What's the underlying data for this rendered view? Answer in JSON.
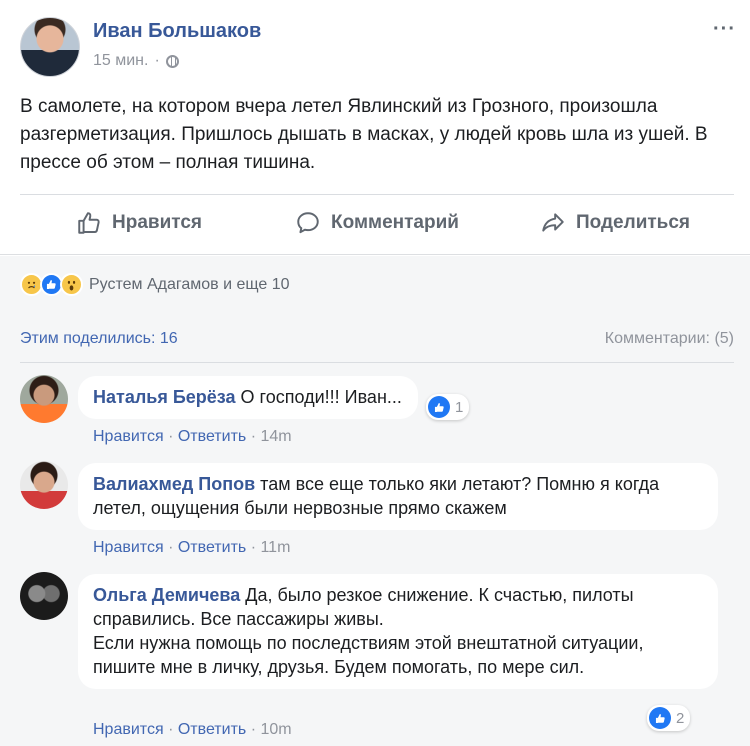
{
  "post": {
    "author": "Иван Большаков",
    "time": "15 мин.",
    "time_sep": "·",
    "more": "···",
    "text": "В самолете, на котором вчера летел Явлинский из Грозного, произошла разгерметизация. Пришлось дышать в масках, у людей кровь шла из ушей. В прессе об этом – полная тишина.",
    "actions": {
      "like": "Нравится",
      "comment": "Комментарий",
      "share": "Поделиться"
    }
  },
  "reactions": {
    "text": "Рустем Адагамов и еще 10",
    "icons": [
      "sad-reaction-icon",
      "like-reaction-icon",
      "wow-reaction-icon"
    ]
  },
  "stats": {
    "shares": "Этим поделились: 16",
    "comments": "Комментарии: (5)"
  },
  "comments": [
    {
      "name": "Наталья Берёза",
      "text": "О господи!!! Иван...",
      "like": "Нравится",
      "reply": "Ответить",
      "time": "14m",
      "likes": "1"
    },
    {
      "name": "Валиахмед Попов",
      "text": "там все еще только яки летают? Помню я когда летел, ощущения были нервозные прямо скажем",
      "like": "Нравится",
      "reply": "Ответить",
      "time": "11m"
    },
    {
      "name": "Ольга Демичева",
      "text": "Да, было резкое снижение. К счастью, пилоты справились. Все пассажиры живы.",
      "text2": "Если нужна помощь по последствиям этой внештатной ситуации, пишите мне в личку, друзья. Будем помогать, по мере сил.",
      "like": "Нравится",
      "reply": "Ответить",
      "time": "10m",
      "likes": "2"
    }
  ],
  "colors": {
    "link": "#385898",
    "accent": "#4267b2",
    "muted": "#90949c",
    "background": "#f5f6f7"
  }
}
